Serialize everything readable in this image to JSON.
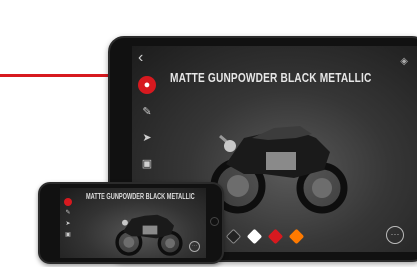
{
  "tablet": {
    "back_icon": "chevron-left-icon",
    "title": "MATTE GUNPOWDER BLACK METALLIC",
    "toolbar": [
      {
        "icon": "color-drop-icon",
        "glyph": "💧",
        "active": true
      },
      {
        "icon": "leaf-icon",
        "glyph": "✎",
        "active": false
      },
      {
        "icon": "send-icon",
        "glyph": "➤",
        "active": false
      },
      {
        "icon": "panel-icon",
        "glyph": "▣",
        "active": false
      }
    ],
    "swatches": [
      "#222222",
      "#ffffff",
      "#d7191f",
      "#ff7a00"
    ],
    "more_label": "···"
  },
  "phone": {
    "title": "MATTE GUNPOWDER BLACK METALLIC",
    "more_label": "···"
  },
  "colors": {
    "accent": "#d7191f"
  }
}
